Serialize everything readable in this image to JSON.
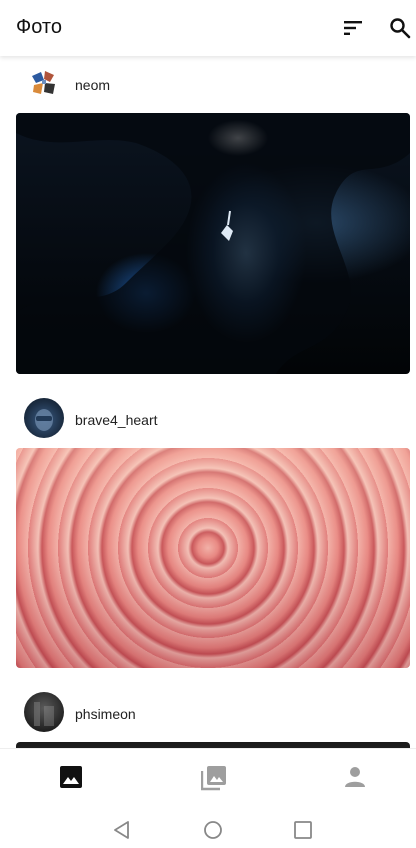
{
  "appbar": {
    "title": "Фото",
    "icons": [
      "sort-icon",
      "search-icon"
    ]
  },
  "posts": [
    {
      "username": "neom",
      "avatar_icon": "neom-logo-avatar",
      "photo": "underwater-cave-diver"
    },
    {
      "username": "brave4_heart",
      "avatar_icon": "user-avatar",
      "photo": "pink-paper-spiral"
    },
    {
      "username": "phsimeon",
      "avatar_icon": "user-avatar",
      "photo": "dark-photo"
    }
  ],
  "bottom_nav": {
    "items": [
      {
        "icon": "photo-icon",
        "selected": true
      },
      {
        "icon": "albums-icon",
        "selected": false
      },
      {
        "icon": "profile-icon",
        "selected": false
      }
    ]
  },
  "system_nav": [
    "back-icon",
    "home-icon",
    "recent-apps-icon"
  ],
  "colors": {
    "appbar_bg": "#ffffff",
    "active_icon": "#111111",
    "inactive_icon": "#9e9e9e",
    "system_icon": "#888888"
  }
}
